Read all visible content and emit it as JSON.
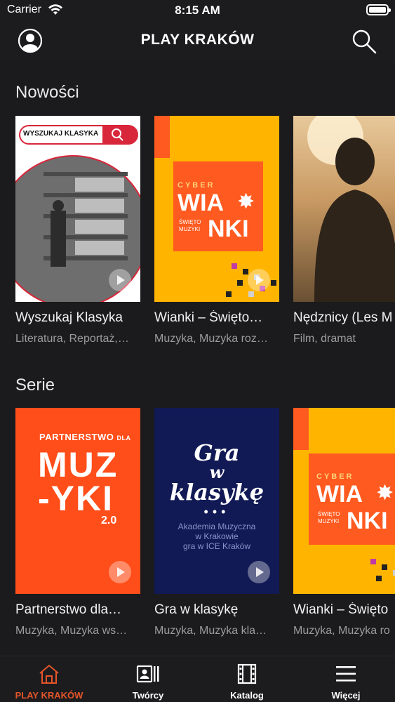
{
  "status": {
    "carrier": "Carrier",
    "time": "8:15 AM"
  },
  "header": {
    "title": "PLAY KRAKÓW"
  },
  "sections": [
    {
      "title": "Nowości",
      "cards": [
        {
          "title": "Wyszukaj Klasyka",
          "subtitle": "Literatura, Reportaż,…",
          "art": {
            "search_label": "WYSZUKAJ KLASYKA"
          }
        },
        {
          "title": "Wianki – Święto…",
          "subtitle": "Muzyka, Muzyka roz…",
          "art": {
            "line1": "CYBER",
            "line2": "WIA",
            "line3": "ŚWIĘTO",
            "line4": "MUZYKI",
            "line5": "NKI"
          }
        },
        {
          "title": "Nędznicy (Les M",
          "subtitle": "Film, dramat"
        }
      ]
    },
    {
      "title": "Serie",
      "cards": [
        {
          "title": "Partnerstwo dla…",
          "subtitle": "Muzyka, Muzyka ws…",
          "art": {
            "line1": "PARTNERSTWO",
            "line1b": "DLA",
            "line2": "MUZ",
            "line3": "-YKI",
            "line4": "2.0"
          }
        },
        {
          "title": "Gra w klasykę",
          "subtitle": "Muzyka, Muzyka kla…",
          "art": {
            "line1": "Gra",
            "line2": "w",
            "line3": "klasykę",
            "line4": "Akademia Muzyczna",
            "line5": "w Krakowie",
            "line6": "gra w ICE Kraków"
          }
        },
        {
          "title": "Wianki – Święto",
          "subtitle": "Muzyka, Muzyka ro",
          "art": {
            "line1": "CYBER",
            "line2": "WIA",
            "line3": "ŚWIĘTO",
            "line4": "MUZYKI",
            "line5": "NKI"
          }
        }
      ]
    }
  ],
  "tabs": [
    {
      "label": "PLAY KRAKÓW",
      "icon": "home-icon",
      "active": true
    },
    {
      "label": "Twórcy",
      "icon": "creators-icon",
      "active": false
    },
    {
      "label": "Katalog",
      "icon": "film-icon",
      "active": false
    },
    {
      "label": "Więcej",
      "icon": "menu-icon",
      "active": false
    }
  ],
  "colors": {
    "accent": "#e5552a",
    "background": "#1b1b1d",
    "wianki_orange": "#ff5a1f",
    "wianki_yellow": "#ffb400",
    "gra_navy": "#111a55"
  }
}
